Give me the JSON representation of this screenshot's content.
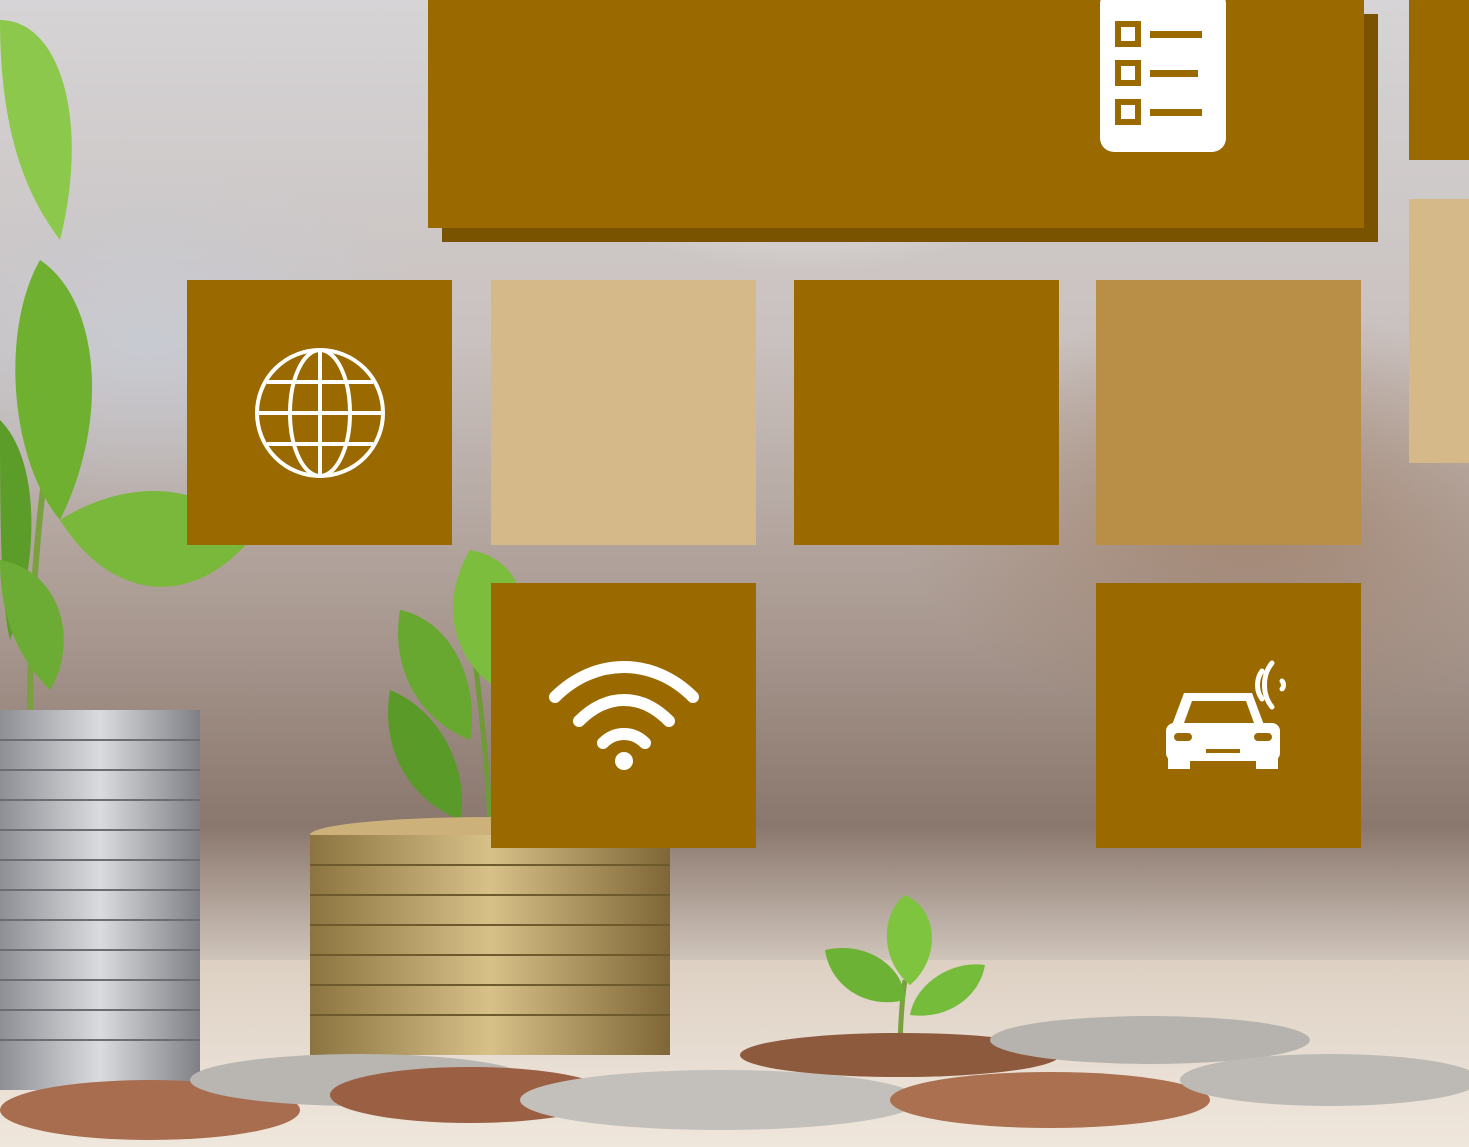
{
  "colors": {
    "tile_dark": "#9a6a00",
    "tile_mid": "#b98f48",
    "tile_light": "#d6b989",
    "icon": "#ffffff"
  },
  "icons": {
    "banner": "checklist-icon",
    "globe_tile": "globe-icon",
    "wifi_tile": "wifi-icon",
    "car_tile": "connected-car-icon"
  },
  "background": "plants-growing-from-coin-stacks-photo"
}
